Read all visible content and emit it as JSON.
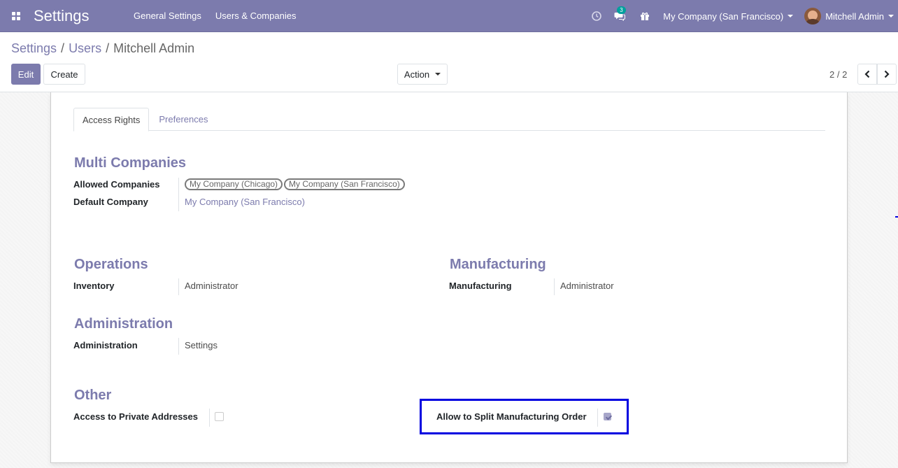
{
  "navbar": {
    "app_title": "Settings",
    "menu": [
      "General Settings",
      "Users & Companies"
    ],
    "messages_count": "3",
    "company_switcher": "My Company (San Francisco)",
    "user_name": "Mitchell Admin"
  },
  "breadcrumb": {
    "items": [
      "Settings",
      "Users"
    ],
    "current": "Mitchell Admin",
    "separator": "/"
  },
  "toolbar": {
    "edit_label": "Edit",
    "create_label": "Create",
    "action_label": "Action",
    "pager": "2 / 2"
  },
  "tabs": [
    {
      "label": "Access Rights",
      "active": true
    },
    {
      "label": "Preferences",
      "active": false
    }
  ],
  "multi_companies": {
    "title": "Multi Companies",
    "allowed_label": "Allowed Companies",
    "allowed_tags": [
      "My Company (Chicago)",
      "My Company (San Francisco)"
    ],
    "default_label": "Default Company",
    "default_value": "My Company (San Francisco)"
  },
  "operations": {
    "title": "Operations",
    "inventory_label": "Inventory",
    "inventory_value": "Administrator"
  },
  "manufacturing": {
    "title": "Manufacturing",
    "manufacturing_label": "Manufacturing",
    "manufacturing_value": "Administrator"
  },
  "administration": {
    "title": "Administration",
    "administration_label": "Administration",
    "administration_value": "Settings"
  },
  "other": {
    "title": "Other",
    "private_addresses_label": "Access to Private Addresses",
    "private_addresses_checked": false,
    "split_mo_label": "Allow to Split Manufacturing Order",
    "split_mo_checked": true
  },
  "colors": {
    "brand": "#7c7bad",
    "badge": "#00a09d",
    "highlight": "#0000e0"
  },
  "icons": [
    "apps-grid-icon",
    "clock-icon",
    "chat-icon",
    "gift-icon",
    "chevron-left-icon",
    "chevron-right-icon"
  ]
}
